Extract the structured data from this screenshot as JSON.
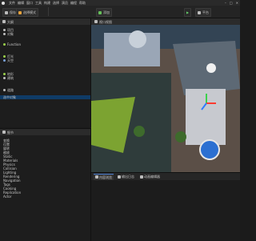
{
  "menu": {
    "items": [
      "文件",
      "编辑",
      "窗口",
      "工具",
      "构建",
      "选择",
      "演员",
      "编程",
      "帮助"
    ]
  },
  "window_controls": [
    "–",
    "□",
    "✕"
  ],
  "toolbar": {
    "save_label": "保存",
    "mode_label": "选择模式",
    "add_label": "添加",
    "play_label": "▶",
    "settings_label": "平台"
  },
  "outliner": {
    "title": "大纲",
    "items": [
      {
        "label": "项目"
      },
      {
        "label": "对象"
      },
      {
        "label": "Function"
      },
      {
        "label": "灯光"
      },
      {
        "label": "天空"
      },
      {
        "label": "地形"
      },
      {
        "label": "建筑"
      },
      {
        "label": "道路"
      }
    ],
    "selected_label": "选中对象"
  },
  "details": {
    "title": "细节",
    "items": [
      {
        "label": "变换"
      },
      {
        "label": "位置"
      },
      {
        "label": "旋转"
      },
      {
        "label": "缩放"
      },
      {
        "label": "Static"
      },
      {
        "label": "Materials"
      },
      {
        "label": "Physics"
      },
      {
        "label": "Collision"
      },
      {
        "label": "Lighting"
      },
      {
        "label": "Rendering"
      },
      {
        "label": "Navigation"
      },
      {
        "label": "Tags"
      },
      {
        "label": "Cooking"
      },
      {
        "label": "Replication"
      },
      {
        "label": "Actor"
      }
    ]
  },
  "viewport": {
    "tab_label": "视口视图",
    "colors": {
      "sky": "#2f3e4a",
      "ground": "#6b5f52",
      "grass": "#7ca331",
      "accent": "#2c6fd1"
    }
  },
  "bottom": {
    "tabs": [
      {
        "label": "内容浏览"
      },
      {
        "label": "输出日志"
      },
      {
        "label": "动画编辑器"
      }
    ]
  }
}
